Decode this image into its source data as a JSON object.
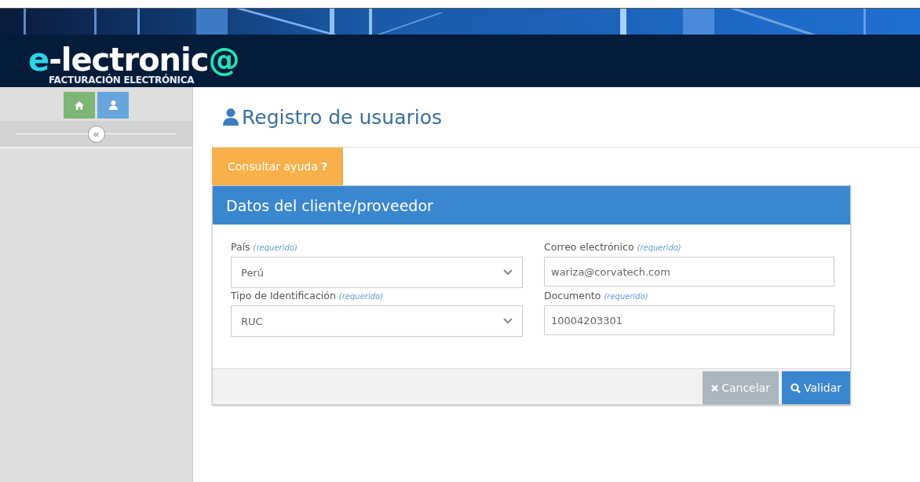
{
  "header": {
    "logo": {
      "lead": "e",
      "main": "-lectronic",
      "tail": "@"
    },
    "tagline": "FACTURACIÓN ELECTRÓNICA"
  },
  "sidebar": {
    "buttons": [
      {
        "kind": "home"
      },
      {
        "kind": "user"
      }
    ],
    "collapse": "«"
  },
  "page": {
    "title": "Registro de usuarios",
    "help": {
      "label": "Consultar ayuda",
      "mark": "?"
    }
  },
  "panel": {
    "title": "Datos del cliente/proveedor",
    "fields": [
      {
        "label": "País",
        "note": "(requerido)",
        "kind": "select",
        "value": "Perú"
      },
      {
        "label": "Correo electrónico",
        "note": "(requerido)",
        "kind": "text",
        "value": "wariza@corvatech.com"
      },
      {
        "label": "Tipo de Identificación",
        "note": "(requerido)",
        "kind": "select",
        "value": "RUC"
      },
      {
        "label": "Documento",
        "note": "(requerido)",
        "kind": "text",
        "value": "10004203301"
      }
    ],
    "buttons": [
      {
        "label": "Cancelar",
        "kind": "cancel",
        "disabled": true
      },
      {
        "label": "Validar",
        "kind": "validate",
        "disabled": false
      }
    ]
  }
}
